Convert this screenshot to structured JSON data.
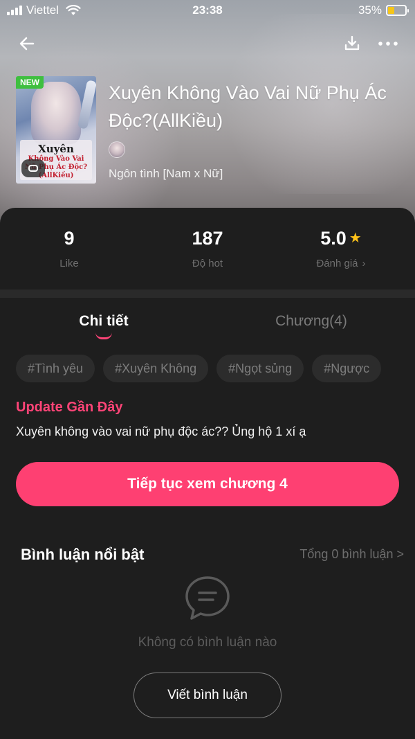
{
  "status_bar": {
    "carrier": "Viettel",
    "time": "23:38",
    "battery_percent": "35%",
    "battery_level": 0.35
  },
  "nav": {
    "back_icon": "arrow-left-icon",
    "download_icon": "download-icon",
    "more_icon": "more-horizontal-icon"
  },
  "book": {
    "badge": "NEW",
    "cover_title": "Xuyên",
    "cover_subtitle": "Không Vào Vai Nữ Phụ Ác Độc?(AllKiều)",
    "title": "Xuyên Không Vào Vai Nữ Phụ Ác Độc?(AllKiều)",
    "genre": "Ngôn tình [Nam x Nữ]"
  },
  "stats": {
    "likes_value": "9",
    "likes_label": "Like",
    "hot_value": "187",
    "hot_label": "Độ hot",
    "rating_value": "5.0",
    "rating_label": "Đánh giá",
    "rating_chevron": "›"
  },
  "tabs": {
    "detail": "Chi tiết",
    "chapters": "Chương(4)"
  },
  "tags": [
    "#Tình yêu",
    "#Xuyên Không",
    "#Ngọt sủng",
    "#Ngược"
  ],
  "update": {
    "title": "Update Gần Đây",
    "text": "Xuyên không vào vai nữ phụ độc ác?? Ủng hộ 1 xí ạ"
  },
  "continue_button": "Tiếp tục xem chương 4",
  "comments": {
    "title": "Bình luận nổi bật",
    "total": "Tổng 0 bình luận >",
    "empty_text": "Không có bình luận nào",
    "write_button": "Viết bình luận"
  },
  "colors": {
    "accent": "#fe4072",
    "star": "#ffc21a",
    "badge_green": "#3fbf3f",
    "background": "#1e1e1e"
  }
}
